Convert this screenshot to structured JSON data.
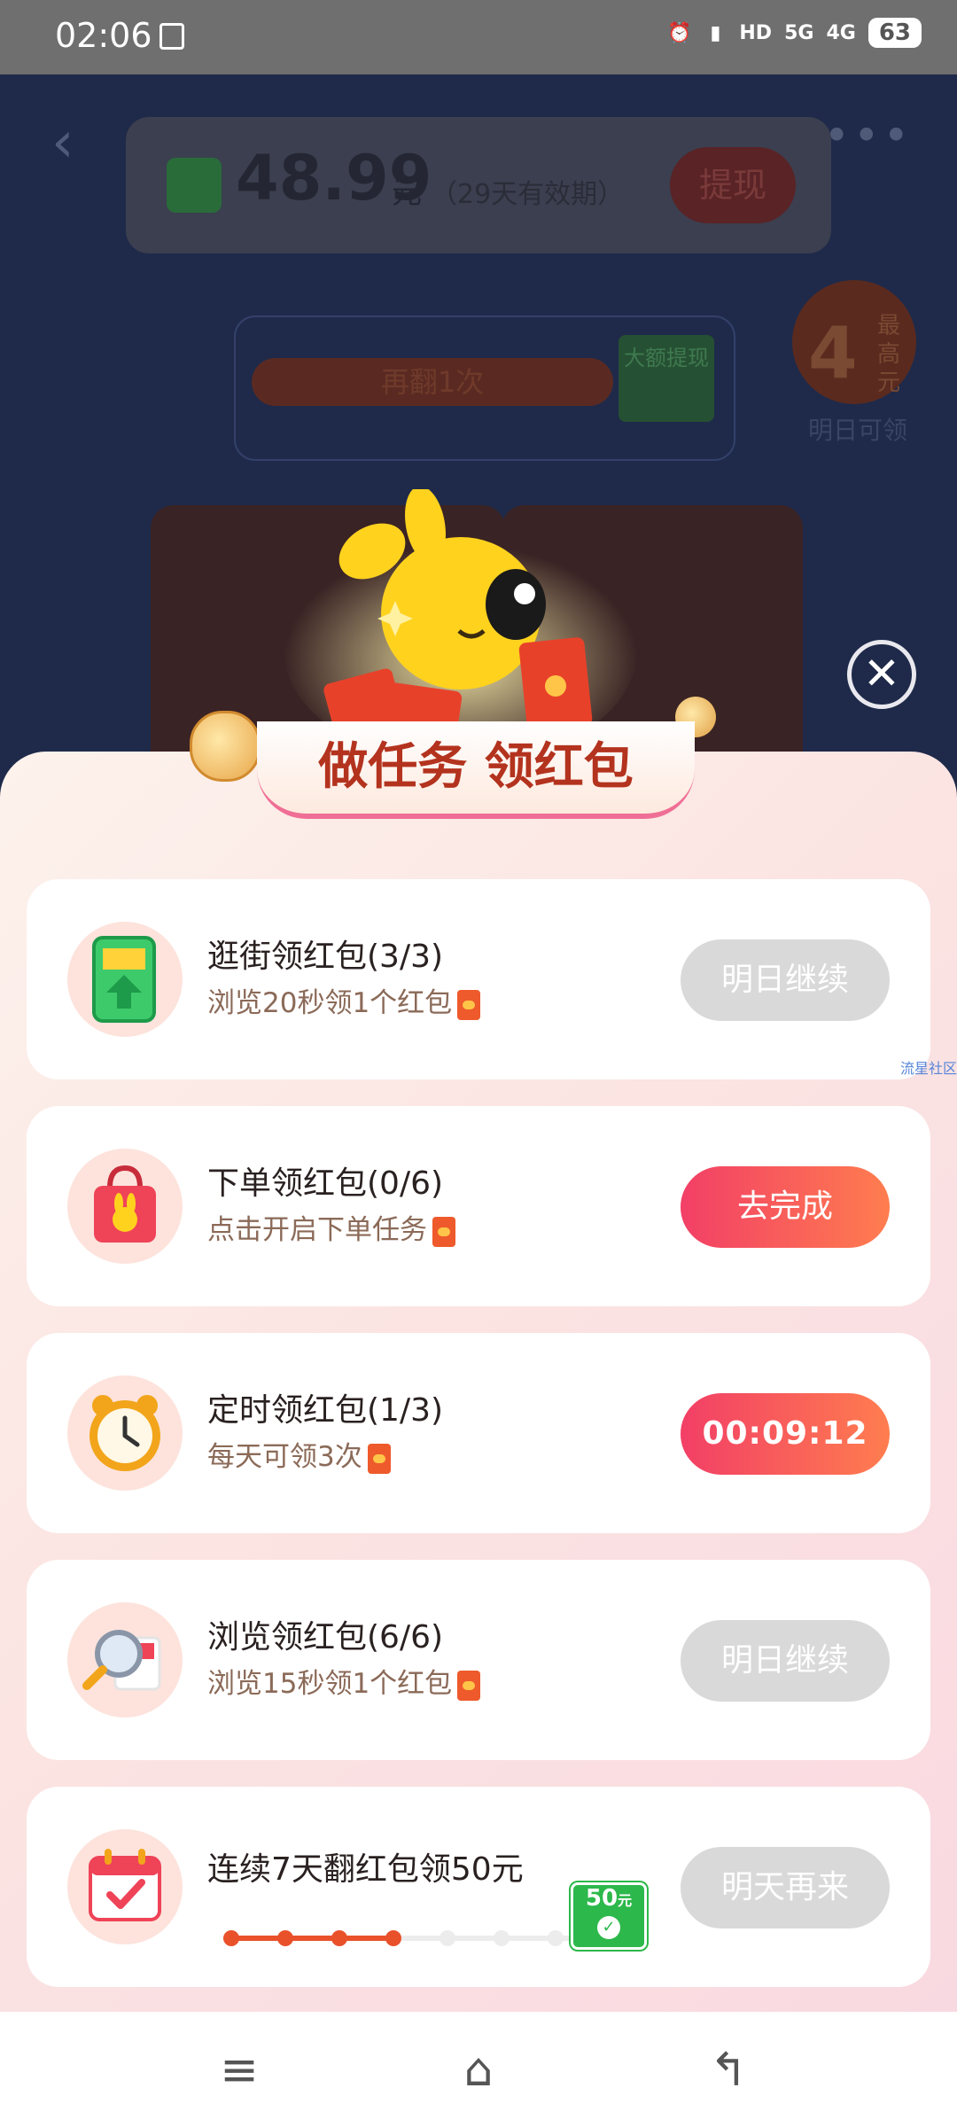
{
  "status_bar": {
    "time": "02:06",
    "battery": "63",
    "network_a": "5G",
    "network_b": "4G",
    "hd": "HD"
  },
  "background": {
    "amount": "48.99",
    "unit": "元",
    "validity": "（29天有效期）",
    "withdraw_label": "提现",
    "flip_label": "再翻1次",
    "tag_label": "大额提现",
    "max_value": "4",
    "max_label": "最高元",
    "tomorrow_label": "明日可领"
  },
  "sheet": {
    "title": "做任务 领红包",
    "tasks": [
      {
        "title": "逛街领红包(3/3)",
        "subtitle": "浏览20秒领1个红包",
        "button": "明日继续",
        "state": "done"
      },
      {
        "title": "下单领红包(0/6)",
        "subtitle": "点击开启下单任务",
        "button": "去完成",
        "state": "active"
      },
      {
        "title": "定时领红包(1/3)",
        "subtitle": "每天可领3次",
        "button": "00:09:12",
        "state": "timer"
      },
      {
        "title": "浏览领红包(6/6)",
        "subtitle": "浏览15秒领1个红包",
        "button": "明日继续",
        "state": "done"
      },
      {
        "title": "连续7天翻红包领50元",
        "subtitle": "",
        "button": "明天再来",
        "state": "done"
      }
    ],
    "streak": {
      "days_done": 4,
      "days_total": 7,
      "reward_amount": "50",
      "reward_unit": "元"
    }
  },
  "watermark": "流星社区",
  "colors": {
    "accent_red": "#f23f66",
    "accent_orange": "#ff7d4f",
    "title_red": "#b3331e"
  }
}
